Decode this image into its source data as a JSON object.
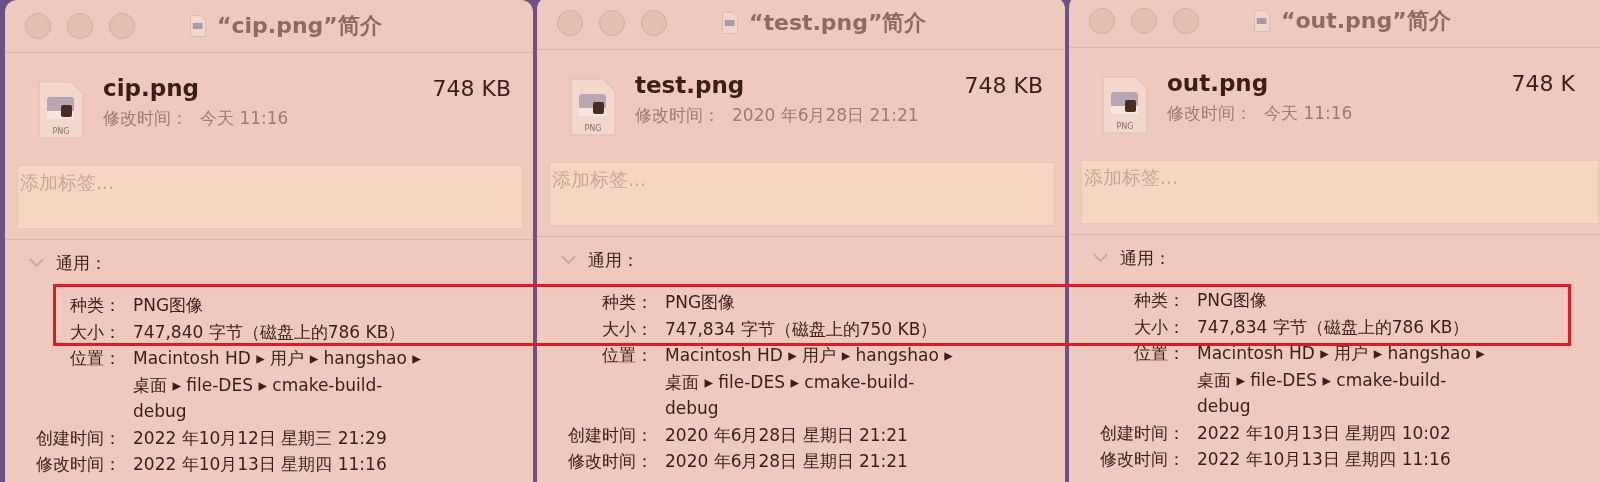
{
  "windows": [
    {
      "title": "“cip.png”简介",
      "file_name": "cip.png",
      "size": "748 KB",
      "icon_label": "PNG",
      "modified_label": "修改时间：",
      "modified": "今天 11:16",
      "tags": {
        "placeholder": "添加标签..."
      },
      "section": {
        "title": "通用：",
        "expanded": true
      },
      "rows": [
        {
          "label": "种类：",
          "value": "PNG图像"
        },
        {
          "label": "大小：",
          "value": "747,840 字节（磁盘上的786 KB）"
        },
        {
          "label": "位置：",
          "value": "Macintosh HD ▸ 用户 ▸ hangshao ▸ 桌面 ▸ file-DES ▸ cmake-build-debug"
        },
        {
          "label": "创建时间：",
          "value": "2022 年10月12日 星期三 21:29"
        },
        {
          "label": "修改时间：",
          "value": "2022 年10月13日 星期四 11:16"
        }
      ]
    },
    {
      "title": "“test.png”简介",
      "file_name": "test.png",
      "size": "748 KB",
      "icon_label": "PNG",
      "modified_label": "修改时间：",
      "modified": "2020 年6月28日 21:21",
      "tags": {
        "placeholder": "添加标签..."
      },
      "section": {
        "title": "通用：",
        "expanded": true
      },
      "rows": [
        {
          "label": "种类：",
          "value": "PNG图像"
        },
        {
          "label": "大小：",
          "value": "747,834 字节（磁盘上的750 KB）"
        },
        {
          "label": "位置：",
          "value": "Macintosh HD ▸ 用户 ▸ hangshao ▸ 桌面 ▸ file-DES ▸ cmake-build-debug"
        },
        {
          "label": "创建时间：",
          "value": "2020 年6月28日 星期日 21:21"
        },
        {
          "label": "修改时间：",
          "value": "2020 年6月28日 星期日 21:21"
        }
      ]
    },
    {
      "title": "“out.png”简介",
      "file_name": "out.png",
      "size": "748 K",
      "icon_label": "PNG",
      "modified_label": "修改时间：",
      "modified": "今天 11:16",
      "tags": {
        "placeholder": "添加标签..."
      },
      "section": {
        "title": "通用：",
        "expanded": true
      },
      "rows": [
        {
          "label": "种类：",
          "value": "PNG图像"
        },
        {
          "label": "大小：",
          "value": "747,834 字节（磁盘上的786 KB）"
        },
        {
          "label": "位置：",
          "value": "Macintosh HD ▸ 用户 ▸ hangshao ▸ 桌面 ▸ file-DES ▸ cmake-build-debug"
        },
        {
          "label": "创建时间：",
          "value": "2022 年10月13日 星期四 10:02"
        },
        {
          "label": "修改时间：",
          "value": "2022 年10月13日 星期四 11:16"
        }
      ]
    }
  ]
}
